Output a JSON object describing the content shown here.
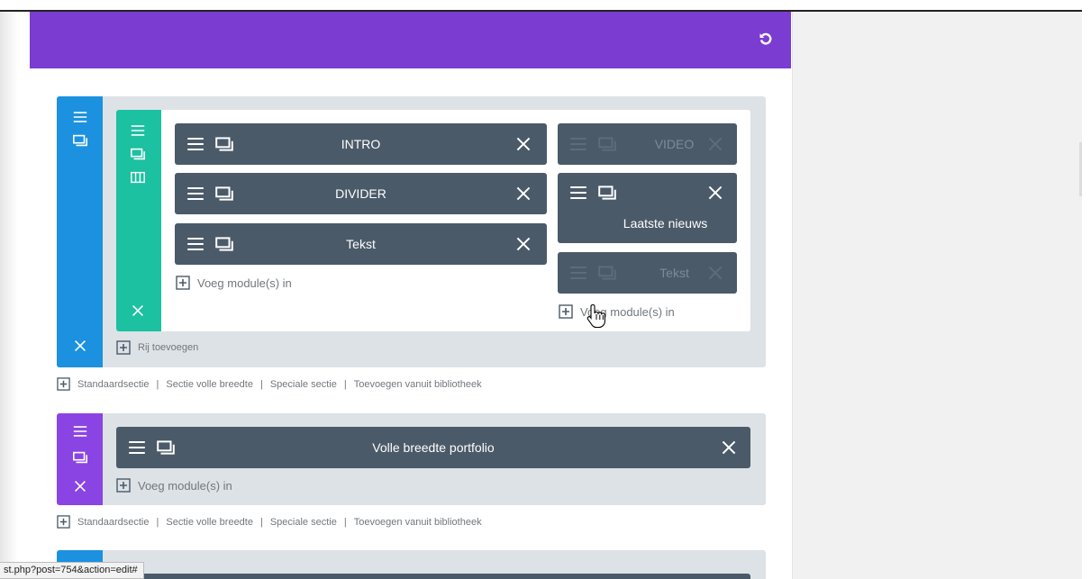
{
  "header": {
    "undo_icon": "undo-icon",
    "color": "#7b3cd2"
  },
  "sections": [
    {
      "handle_color": "#1b91e0",
      "row": {
        "columns": [
          {
            "modules": [
              {
                "label": "INTRO",
                "faded": false
              },
              {
                "label": "DIVIDER",
                "faded": false
              },
              {
                "label": "Tekst",
                "faded": false
              }
            ],
            "add_label": "Voeg module(s) in"
          },
          {
            "modules": [
              {
                "label": "VIDEO",
                "faded": true
              },
              {
                "label": "Laatste nieuws",
                "faded": false
              },
              {
                "label": "Tekst",
                "faded": true
              }
            ],
            "add_label": "Voeg module(s) in"
          }
        ]
      },
      "add_row_label": "Rij toevoegen"
    },
    {
      "handle_color": "#8a44e3",
      "module": {
        "label": "Volle breedte portfolio"
      },
      "add_label": "Voeg module(s) in"
    }
  ],
  "section_links": [
    "Standaardsectie",
    "Sectie volle breedte",
    "Speciale sectie",
    "Toevoegen vanuit bibliotheek"
  ],
  "status_url": "st.php?post=754&action=edit#",
  "colors": {
    "row_handle": "#1bc1a1",
    "module": "#4b5a69",
    "section_bg": "#dde2e6"
  }
}
